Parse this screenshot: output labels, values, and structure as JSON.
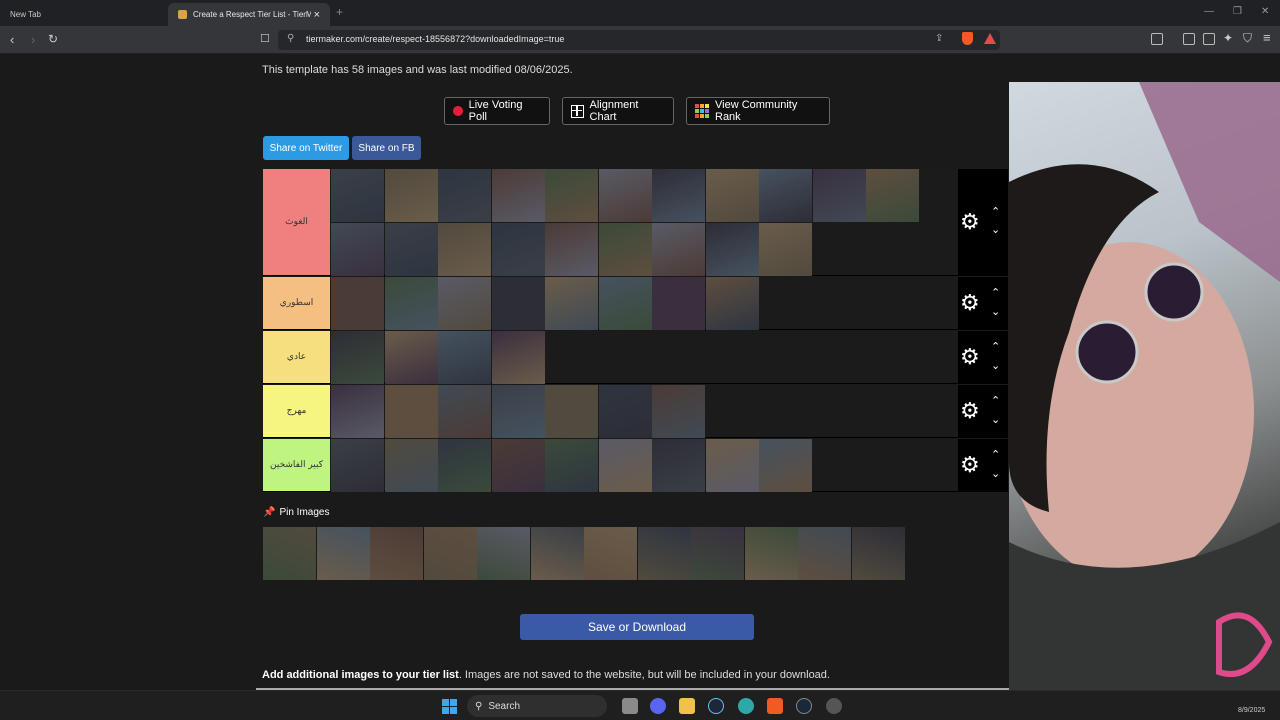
{
  "browser": {
    "tabs": [
      {
        "title": "New Tab"
      },
      {
        "title": "Create a Respect Tier List - TierM"
      }
    ],
    "url": "tiermaker.com/create/respect-18556872?downloadedImage=true"
  },
  "page": {
    "template_info": "This template has 58 images and was last modified 08/06/2025.",
    "buttons": {
      "poll": "Live Voting Poll",
      "alignment": "Alignment Chart",
      "rank": "View Community Rank"
    },
    "share": {
      "twitter": "Share on Twitter",
      "fb": "Share on FB"
    },
    "tiers": [
      {
        "label": "الغوث",
        "color": "#f07f7f",
        "item_count": 20
      },
      {
        "label": "اسطوري",
        "color": "#f5bf7f",
        "item_count": 8
      },
      {
        "label": "عادي",
        "color": "#f5df7f",
        "item_count": 4
      },
      {
        "label": "مهرج",
        "color": "#f5f57f",
        "item_count": 7
      },
      {
        "label": "كبير الفاشخين",
        "color": "#bff57f",
        "item_count": 9
      }
    ],
    "pin_label": "Pin Images",
    "pool_count": 12,
    "save_button": "Save or Download",
    "add_images_bold": "Add additional images to your tier list",
    "add_images_rest": ". Images are not saved to the website, but will be included in your download."
  },
  "taskbar": {
    "search_label": "Search",
    "date": "8/9/2025"
  }
}
